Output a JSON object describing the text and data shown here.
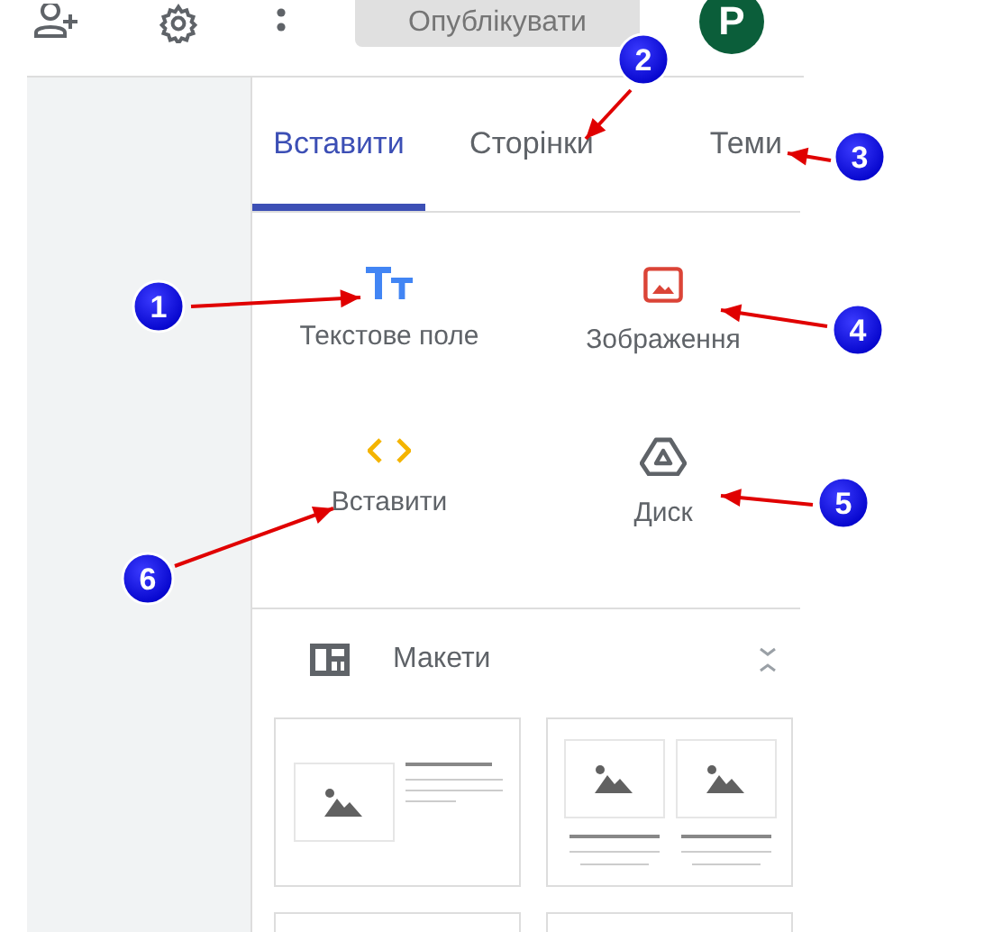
{
  "toolbar": {
    "publish_button": {
      "label": "Опублікувати",
      "disabled": true
    },
    "avatar": {
      "initial": "P"
    }
  },
  "tabs": [
    {
      "label": "Вставити",
      "selected": true
    },
    {
      "label": "Сторінки",
      "selected": false
    },
    {
      "label": "Теми",
      "selected": false
    }
  ],
  "insert_items": [
    {
      "kind": "text",
      "label": "Текстове поле"
    },
    {
      "kind": "image",
      "label": "Зображення"
    },
    {
      "kind": "embed",
      "label": "Вставити"
    },
    {
      "kind": "drive",
      "label": "Диск"
    }
  ],
  "layouts": {
    "title": "Макети",
    "items": [
      {
        "kind": "image-text"
      },
      {
        "kind": "two-images"
      },
      {
        "kind": "blank"
      },
      {
        "kind": "blank"
      }
    ]
  },
  "annotations": [
    {
      "label": "1"
    },
    {
      "label": "2"
    },
    {
      "label": "3"
    },
    {
      "label": "4"
    },
    {
      "label": "5"
    },
    {
      "label": "6"
    }
  ]
}
